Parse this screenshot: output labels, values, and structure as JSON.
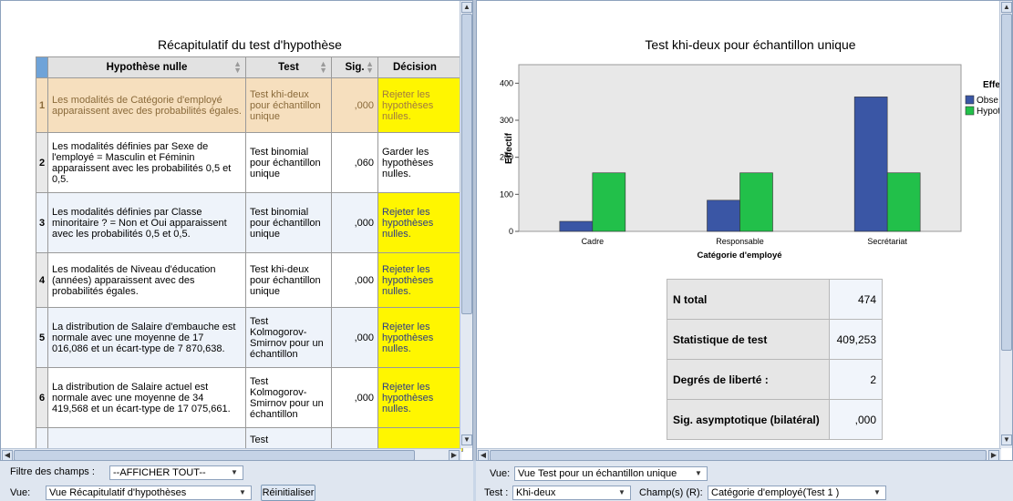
{
  "left_pane": {
    "table_title": "Récapitulatif du test d'hypothèse",
    "columns": [
      "Hypothèse nulle",
      "Test",
      "Sig.",
      "Décision"
    ],
    "rows": [
      {
        "n": "1",
        "hypothesis": "Les modalités de Catégorie d'employé apparaissent avec des probabilités égales.",
        "test": "Test khi-deux pour échantillon unique",
        "sig": ",000",
        "decision": "Rejeter les hypothèses nulles.",
        "decision_type": "reject",
        "selected": true
      },
      {
        "n": "2",
        "hypothesis": "Les modalités définies par Sexe de l'employé = Masculin et Féminin apparaissent avec les probabilités 0,5 et 0,5.",
        "test": "Test binomial pour échantillon unique",
        "sig": ",060",
        "decision": "Garder les hypothèses nulles.",
        "decision_type": "keep",
        "selected": false
      },
      {
        "n": "3",
        "hypothesis": "Les modalités définies par Classe minoritaire ? = Non et Oui apparaissent avec les probabilités 0,5 et 0,5.",
        "test": "Test binomial pour échantillon unique",
        "sig": ",000",
        "decision": "Rejeter les hypothèses nulles.",
        "decision_type": "reject",
        "selected": false
      },
      {
        "n": "4",
        "hypothesis": "Les modalités de Niveau d'éducation (années) apparaissent avec des probabilités égales.",
        "test": "Test khi-deux pour échantillon unique",
        "sig": ",000",
        "decision": "Rejeter les hypothèses nulles.",
        "decision_type": "reject",
        "selected": false
      },
      {
        "n": "5",
        "hypothesis": "La distribution de Salaire d'embauche est normale avec une moyenne de 17 016,086 et un écart-type de 7 870,638.",
        "test": "Test Kolmogorov-Smirnov pour un échantillon",
        "sig": ",000",
        "decision": "Rejeter les hypothèses nulles.",
        "decision_type": "reject",
        "selected": false
      },
      {
        "n": "6",
        "hypothesis": "La distribution de Salaire actuel est normale avec une moyenne de 34 419,568 et un écart-type de 17 075,661.",
        "test": "Test Kolmogorov-Smirnov pour un échantillon",
        "sig": ",000",
        "decision": "Rejeter les hypothèses nulles.",
        "decision_type": "reject",
        "selected": false
      },
      {
        "n": "",
        "hypothesis": "",
        "test": "Test",
        "sig": "",
        "decision": "",
        "decision_type": "reject",
        "selected": false
      }
    ],
    "filter_label": "Filtre des champs :",
    "filter_value": "--AFFICHER TOUT--",
    "view_label": "Vue:",
    "view_value": "Vue Récapitulatif d'hypothèses",
    "reset_button": "Réinitialiser"
  },
  "right_pane": {
    "chart_title": "Test khi-deux pour échantillon unique",
    "legend_title": "Effe",
    "legend_items": [
      "Obse",
      "Hypot"
    ],
    "stats": [
      {
        "label": "N total",
        "value": "474"
      },
      {
        "label": "Statistique de test",
        "value": "409,253"
      },
      {
        "label": "Degrés de liberté :",
        "value": "2"
      },
      {
        "label": "Sig. asymptotique (bilatéral)",
        "value": ",000"
      }
    ],
    "view_label": "Vue:",
    "view_value": "Vue Test pour un échantillon unique",
    "test_label": "Test :",
    "test_value": "Khi-deux",
    "fields_label": "Champ(s) (R):",
    "fields_value": "Catégorie d'employé(Test 1 )"
  },
  "colors": {
    "observed": "#3a56a5",
    "hypothesized": "#22c04a",
    "reject": "#fff600",
    "selected_row": "#f6dfbe",
    "plot_bg": "#e8e8e8"
  },
  "chart_data": {
    "type": "bar",
    "title": "Test khi-deux pour échantillon unique",
    "xlabel": "Catégorie d'employé",
    "ylabel": "Effectif",
    "categories": [
      "Cadre",
      "Responsable",
      "Secrétariat"
    ],
    "series": [
      {
        "name": "Obse",
        "values": [
          27,
          84,
          363
        ],
        "color": "#3a56a5"
      },
      {
        "name": "Hypot",
        "values": [
          158,
          158,
          158
        ],
        "color": "#22c04a"
      }
    ],
    "ylim": [
      0,
      450
    ],
    "yticks": [
      0,
      100,
      200,
      300,
      400
    ],
    "legend_title": "Effe",
    "legend_position": "right",
    "grid": false
  }
}
